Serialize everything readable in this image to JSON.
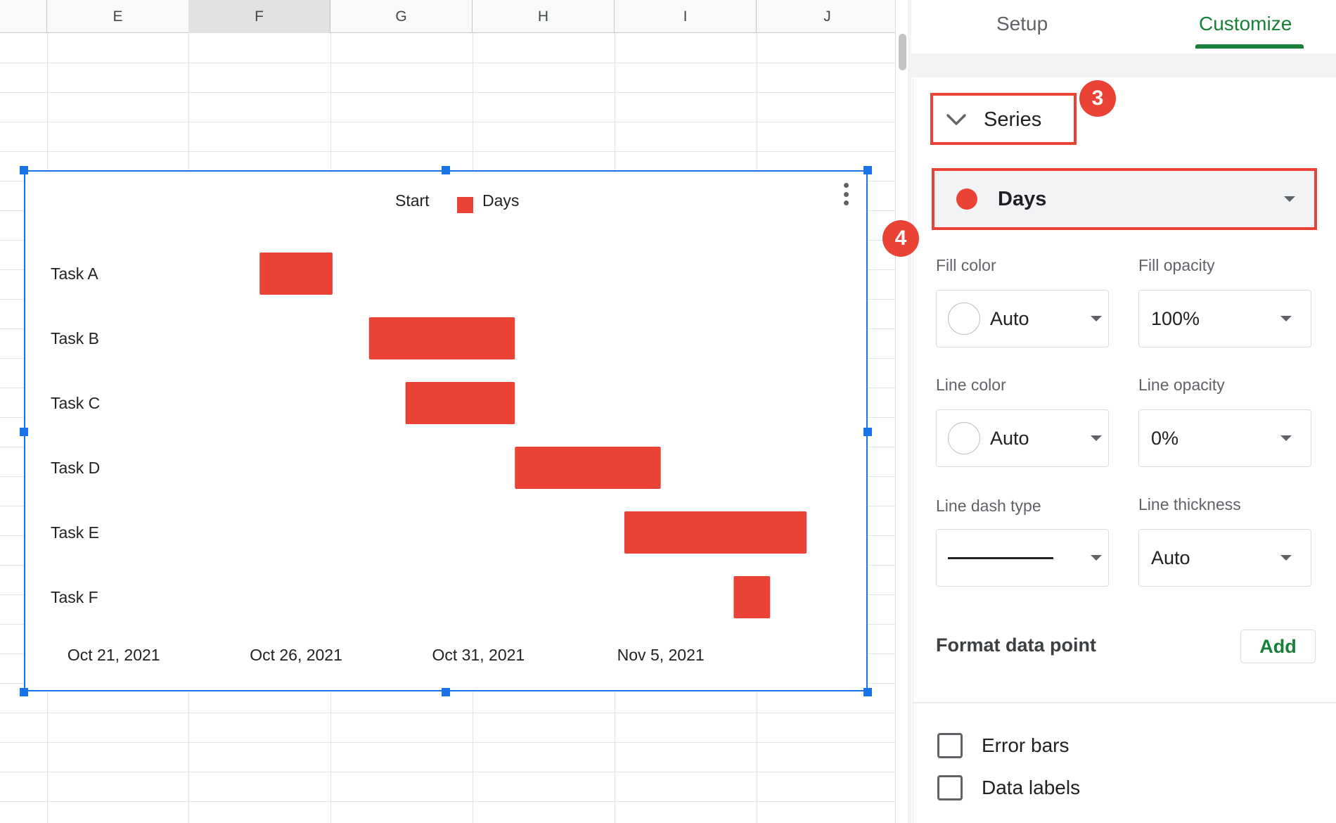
{
  "sheet": {
    "columns": [
      {
        "label": "E",
        "selected": false
      },
      {
        "label": "F",
        "selected": true
      },
      {
        "label": "G",
        "selected": false
      },
      {
        "label": "H",
        "selected": false
      },
      {
        "label": "I",
        "selected": false
      },
      {
        "label": "J",
        "selected": false
      }
    ]
  },
  "chart_data": {
    "type": "bar",
    "orientation": "horizontal",
    "stacked": true,
    "title": "",
    "legend": {
      "position": "top",
      "entries": [
        {
          "name": "Start",
          "color": "#ffffff",
          "show_swatch": false
        },
        {
          "name": "Days",
          "color": "#ea4335",
          "show_swatch": true
        }
      ]
    },
    "categories": [
      "Task A",
      "Task B",
      "Task C",
      "Task D",
      "Task E",
      "Task F"
    ],
    "series": [
      {
        "name": "Start",
        "color": "#ffffff",
        "values": [
          "2021-10-25",
          "2021-10-28",
          "2021-10-29",
          "2021-11-01",
          "2021-11-04",
          "2021-11-07"
        ]
      },
      {
        "name": "Days",
        "color": "#ea4335",
        "values": [
          2,
          4,
          3,
          4,
          5,
          1
        ]
      }
    ],
    "x_ticks": [
      "Oct 21, 2021",
      "Oct 26, 2021",
      "Oct 31, 2021",
      "Nov 5, 2021"
    ],
    "x_tick_dates": [
      "2021-10-21",
      "2021-10-26",
      "2021-10-31",
      "2021-11-05"
    ],
    "xlim": [
      "2021-10-19",
      "2021-11-10"
    ],
    "grid": false
  },
  "panel": {
    "tabs": {
      "setup": "Setup",
      "customize": "Customize"
    },
    "series_section": {
      "label": "Series"
    },
    "series_select": {
      "value": "Days",
      "dot_color": "#ea4335"
    },
    "badges": {
      "three": "3",
      "four": "4"
    },
    "fill_color": {
      "label": "Fill color",
      "value": "Auto"
    },
    "fill_opacity": {
      "label": "Fill opacity",
      "value": "100%"
    },
    "line_color": {
      "label": "Line color",
      "value": "Auto"
    },
    "line_opacity": {
      "label": "Line opacity",
      "value": "0%"
    },
    "line_dash_type": {
      "label": "Line dash type"
    },
    "line_thickness": {
      "label": "Line thickness",
      "value": "Auto"
    },
    "format_data_point": {
      "label": "Format data point",
      "button": "Add"
    },
    "error_bars": {
      "label": "Error bars",
      "checked": false
    },
    "data_labels": {
      "label": "Data labels",
      "checked": false
    }
  }
}
